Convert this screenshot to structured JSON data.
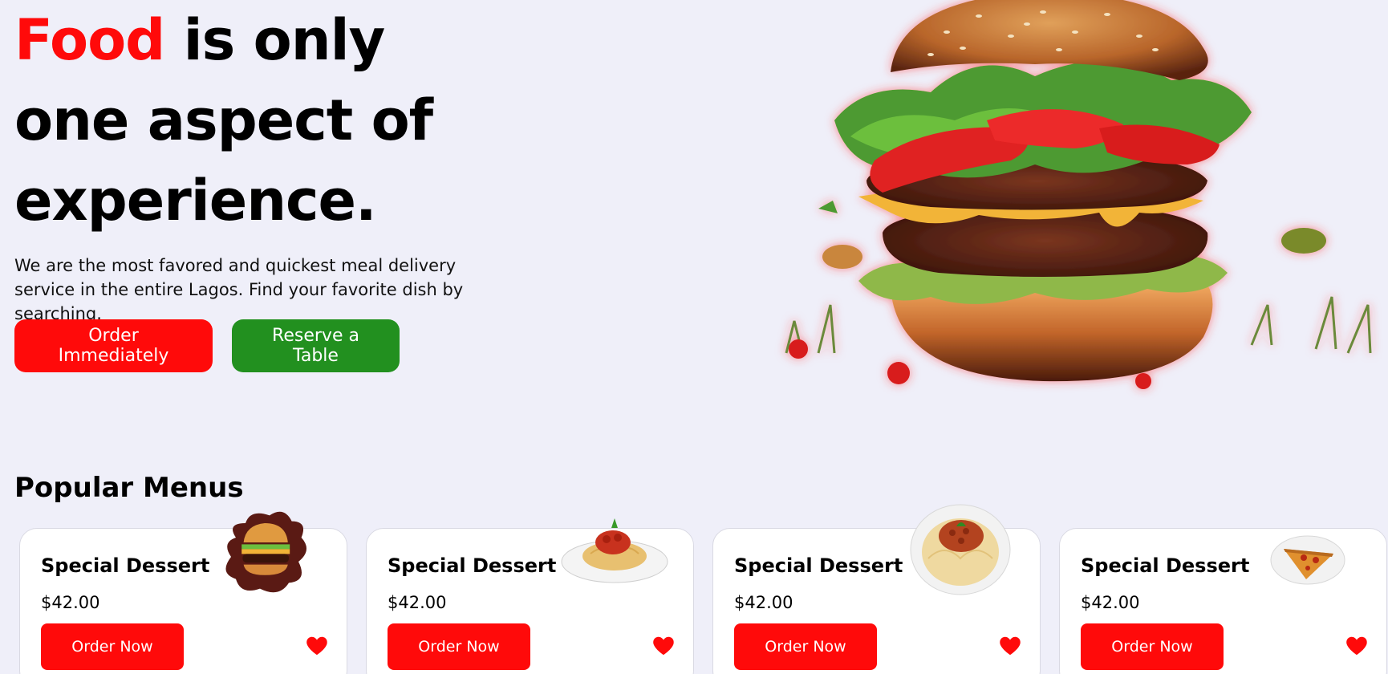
{
  "hero": {
    "title_accent": "Food",
    "title_rest": " is only one aspect of experience.",
    "description": "We are the most favored and quickest meal delivery service in the entire Lagos. Find your favorite dish by searching.",
    "order_label": "Order Immediately",
    "reserve_label": "Reserve a Table",
    "image_icon": "burger-illustration"
  },
  "colors": {
    "accent_red": "#ff0a0a",
    "accent_green": "#22901f",
    "background": "#efeff9"
  },
  "popular": {
    "title": "Popular Menus",
    "cards": [
      {
        "title": "Special Dessert",
        "price": "$42.00",
        "button": "Order Now",
        "image_icon": "burger-icon"
      },
      {
        "title": "Special Dessert",
        "price": "$42.00",
        "button": "Order Now",
        "image_icon": "spaghetti-plate-icon"
      },
      {
        "title": "Special Dessert",
        "price": "$42.00",
        "button": "Order Now",
        "image_icon": "spaghetti-bolognese-icon"
      },
      {
        "title": "Special Dessert",
        "price": "$42.00",
        "button": "Order Now",
        "image_icon": "pizza-slice-icon"
      }
    ]
  }
}
